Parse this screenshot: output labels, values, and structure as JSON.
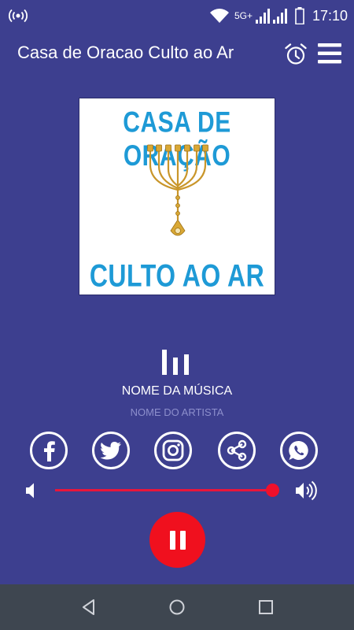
{
  "status_bar": {
    "network": "5G+",
    "time": "17:10",
    "icons": [
      "broadcast-icon",
      "wifi-icon",
      "signal-icon",
      "signal-icon",
      "battery-icon"
    ]
  },
  "app_bar": {
    "title": "Casa de Oracao Culto ao Ar",
    "icons": [
      "alarm-clock-icon",
      "menu-icon"
    ]
  },
  "album_art": {
    "line1": "CASA DE ORAÇÃO",
    "line2": "CULTO AO AR",
    "image": "menorah"
  },
  "now_playing": {
    "song_title": "NOME DA MÚSICA",
    "artist": "NOME DO ARTISTA"
  },
  "social": [
    "facebook-icon",
    "twitter-icon",
    "instagram-icon",
    "share-icon",
    "whatsapp-icon"
  ],
  "volume": {
    "level": 1.0
  },
  "player": {
    "state": "playing",
    "button_icon": "pause-icon"
  },
  "nav": [
    "back-icon",
    "home-icon",
    "recents-icon"
  ],
  "colors": {
    "background": "#3d3f8f",
    "accent": "#f0101e",
    "logo_text": "#1e9ad6",
    "artist_text": "#8d8fcc",
    "nav_bar": "#3e4650"
  }
}
